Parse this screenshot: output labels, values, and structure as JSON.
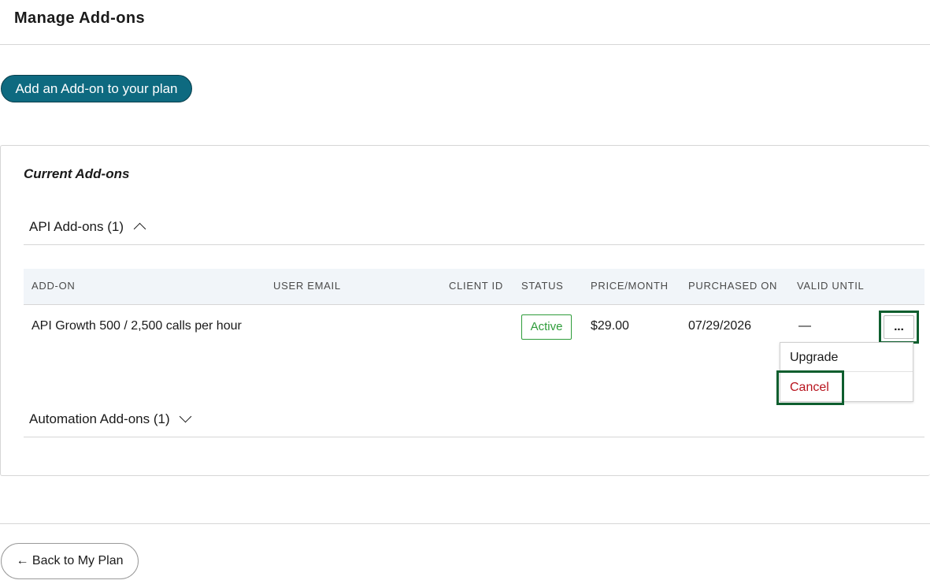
{
  "page": {
    "title": "Manage Add-ons"
  },
  "actions": {
    "add_addon_label": "Add an Add-on to your plan",
    "back_label": "← Back to My Plan"
  },
  "current": {
    "title": "Current Add-ons",
    "groups": [
      {
        "label": "API Add-ons",
        "count": "(1)",
        "expanded": true
      },
      {
        "label": "Automation Add-ons",
        "count": "(1)",
        "expanded": false
      }
    ]
  },
  "table": {
    "columns": [
      "ADD-ON",
      "USER EMAIL",
      "CLIENT ID",
      "STATUS",
      "PRICE/MONTH",
      "PURCHASED ON",
      "VALID UNTIL"
    ],
    "rows": [
      {
        "addon": "API Growth 500 / 2,500 calls per hour",
        "user_email": "",
        "client_id": "",
        "status": "Active",
        "price": "$29.00",
        "purchased_on": "07/29/2026",
        "valid_until": "—",
        "more_label": "..."
      }
    ]
  },
  "row_menu": {
    "items": [
      "Upgrade",
      "Cancel"
    ]
  },
  "colors": {
    "primary": "#0e6a80",
    "status_active": "#2e9c3a",
    "danger": "#b8141e",
    "highlight_frame": "#0e5e2e"
  }
}
